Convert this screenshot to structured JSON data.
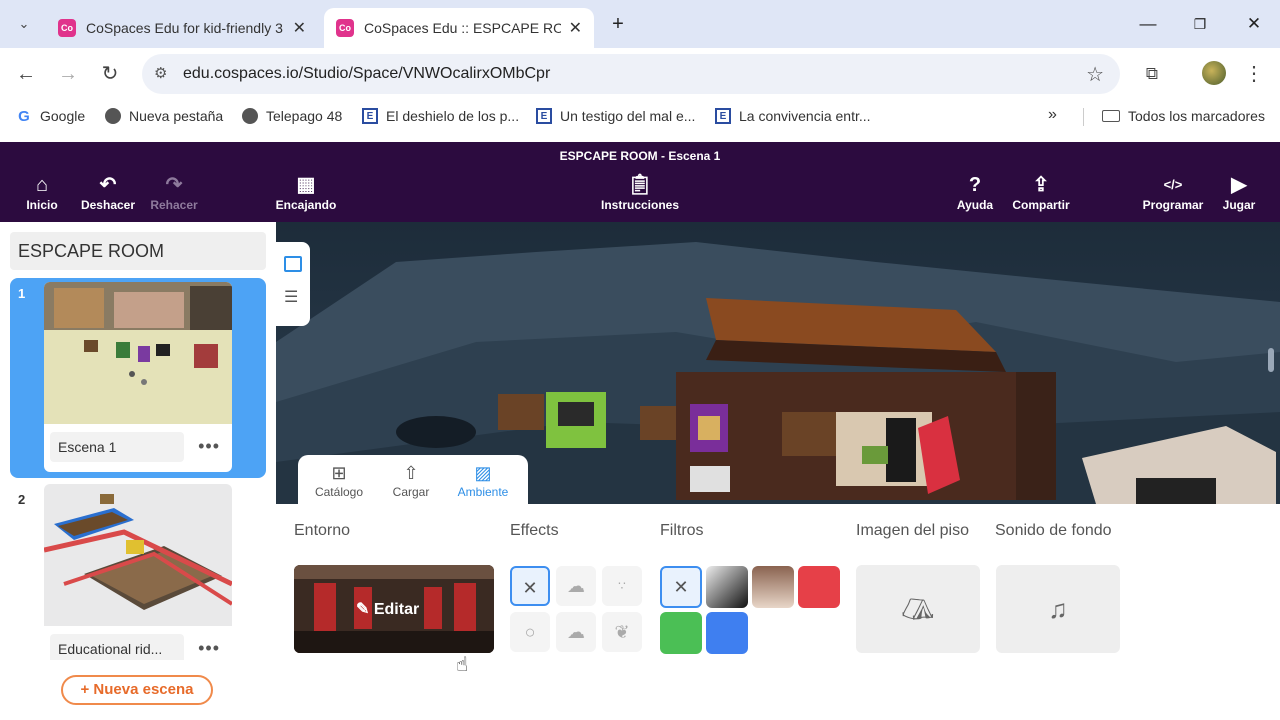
{
  "browser": {
    "tabs": [
      {
        "favicon": "Co",
        "title": "CoSpaces Edu for kid-friendly 3",
        "active": false
      },
      {
        "favicon": "Co",
        "title": "CoSpaces Edu :: ESPCAPE ROOM",
        "active": true
      }
    ],
    "url": "edu.cospaces.io/Studio/Space/VNWOcalirxOMbCpr",
    "bookmarks": [
      {
        "icon": "google-icon",
        "label": "Google"
      },
      {
        "icon": "globe-icon",
        "label": "Nueva pestaña"
      },
      {
        "icon": "globe-icon",
        "label": "Telepago 48"
      },
      {
        "icon": "e-icon",
        "label": "El deshielo de los p..."
      },
      {
        "icon": "e-icon",
        "label": "Un testigo del mal e..."
      },
      {
        "icon": "e-icon",
        "label": "La convivencia entr..."
      }
    ],
    "all_bookmarks": "Todos los marcadores"
  },
  "app": {
    "title": "ESPCAPE ROOM - Escena 1",
    "toolbar": {
      "home": "Inicio",
      "undo": "Deshacer",
      "redo": "Rehacer",
      "snapping": "Encajando",
      "instructions": "Instrucciones",
      "help": "Ayuda",
      "share": "Compartir",
      "code": "Programar",
      "play": "Jugar"
    }
  },
  "scenes_panel": {
    "space_name": "ESPCAPE ROOM",
    "scenes": [
      {
        "number": "1",
        "label": "Escena 1",
        "selected": true
      },
      {
        "number": "2",
        "label": "Educational rid...",
        "selected": false
      }
    ],
    "more": "•••",
    "new_scene": "Nueva escena"
  },
  "bottom_panel": {
    "tabs": [
      {
        "icon": "catalog-icon",
        "label": "Catálogo"
      },
      {
        "icon": "upload-icon",
        "label": "Cargar"
      },
      {
        "icon": "environment-icon",
        "label": "Ambiente",
        "active": true
      }
    ],
    "sections": {
      "environment": "Entorno",
      "effects": "Effects",
      "filters": "Filtros",
      "floor_image": "Imagen del piso",
      "background_sound": "Sonido de fondo"
    },
    "edit_label": "Editar",
    "filter_colors": [
      "#e64048",
      "#4bbf55",
      "#3f7ff0"
    ]
  }
}
